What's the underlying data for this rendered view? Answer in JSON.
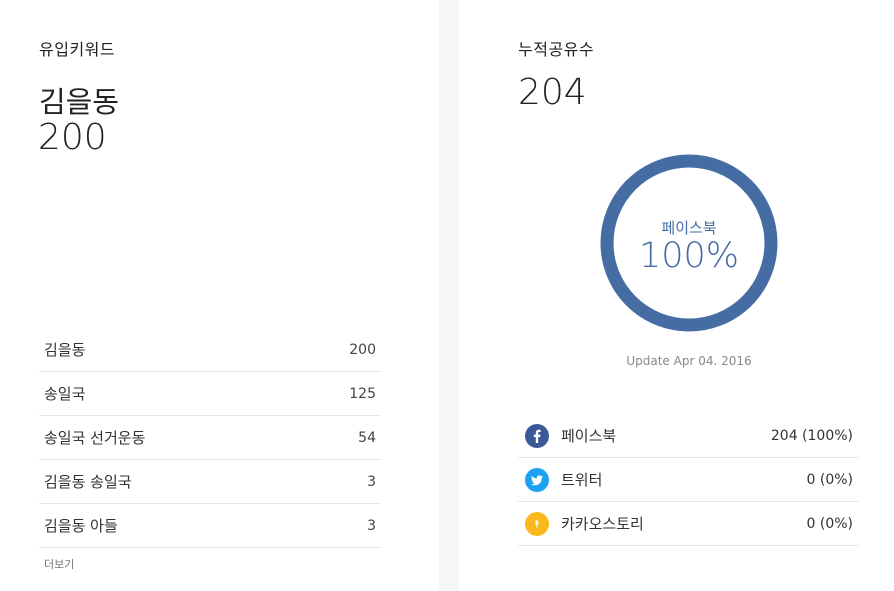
{
  "keywords": {
    "title": "유입키워드",
    "top_name": "김을동",
    "top_count": "200",
    "items": [
      {
        "name": "김을동",
        "value": "200"
      },
      {
        "name": "송일국",
        "value": "125"
      },
      {
        "name": "송일국 선거운동",
        "value": "54"
      },
      {
        "name": "김을동 송일국",
        "value": "3"
      },
      {
        "name": "김을동 아들",
        "value": "3"
      }
    ],
    "more_label": "더보기"
  },
  "shares": {
    "title": "누적공유수",
    "total": "204",
    "donut": {
      "label": "페이스북",
      "percent_text": "100%",
      "fraction": 1.0,
      "color": "#466da3"
    },
    "update_text": "Update Apr 04. 2016",
    "items": [
      {
        "name": "페이스북",
        "value": "204 (100%)",
        "icon": "facebook-icon",
        "color": "#3b5998"
      },
      {
        "name": "트위터",
        "value": "0 (0%)",
        "icon": "twitter-icon",
        "color": "#1da1f2"
      },
      {
        "name": "카카오스토리",
        "value": "0 (0%)",
        "icon": "kakaostory-icon",
        "color": "#f9b81b"
      }
    ]
  }
}
